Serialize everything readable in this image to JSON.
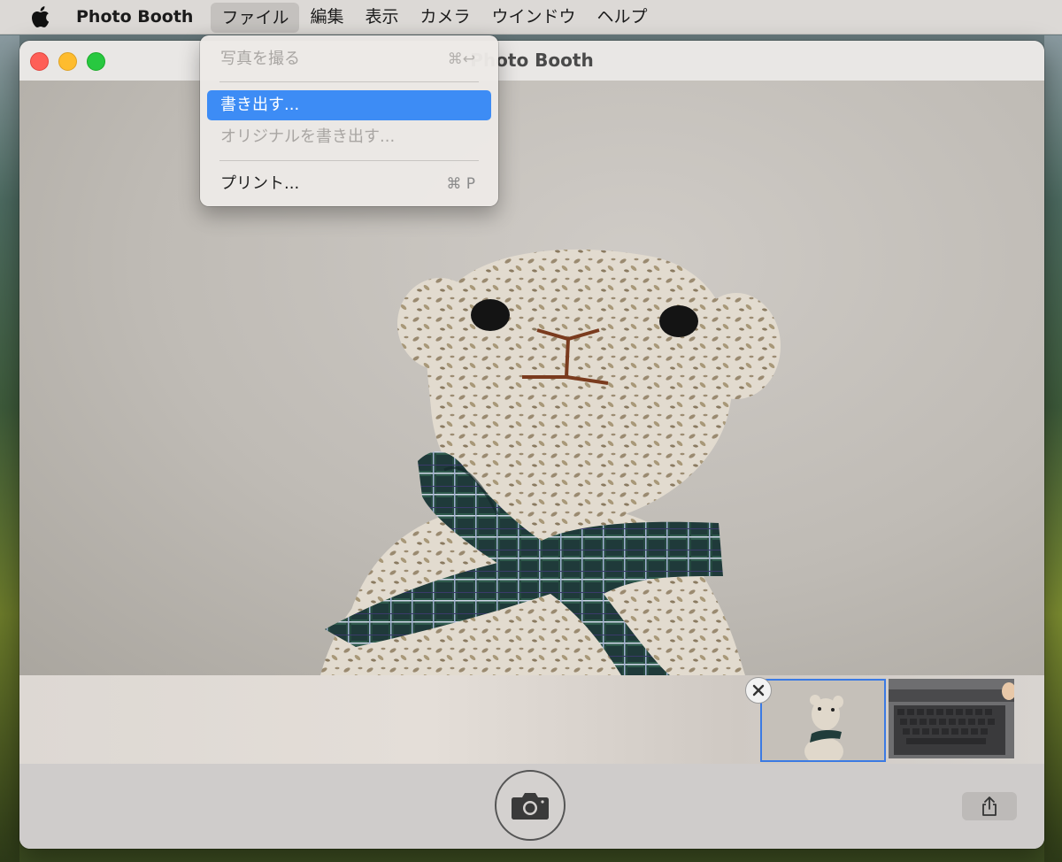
{
  "menubar": {
    "app_name": "Photo Booth",
    "items": [
      "ファイル",
      "編集",
      "表示",
      "カメラ",
      "ウインドウ",
      "ヘルプ"
    ]
  },
  "window": {
    "title": "Photo Booth"
  },
  "file_menu": {
    "take_photo": "写真を撮る",
    "take_photo_shortcut": "⌘↩",
    "export": "書き出す...",
    "export_original": "オリジナルを書き出す...",
    "print": "プリント...",
    "print_shortcut": "⌘ P"
  },
  "colors": {
    "selection": "#3d8cf5",
    "close": "#fe5f57",
    "minimize": "#febc2e",
    "maximize": "#28c840"
  },
  "icons": [
    "apple-icon",
    "close-icon",
    "camera-icon",
    "share-icon"
  ]
}
